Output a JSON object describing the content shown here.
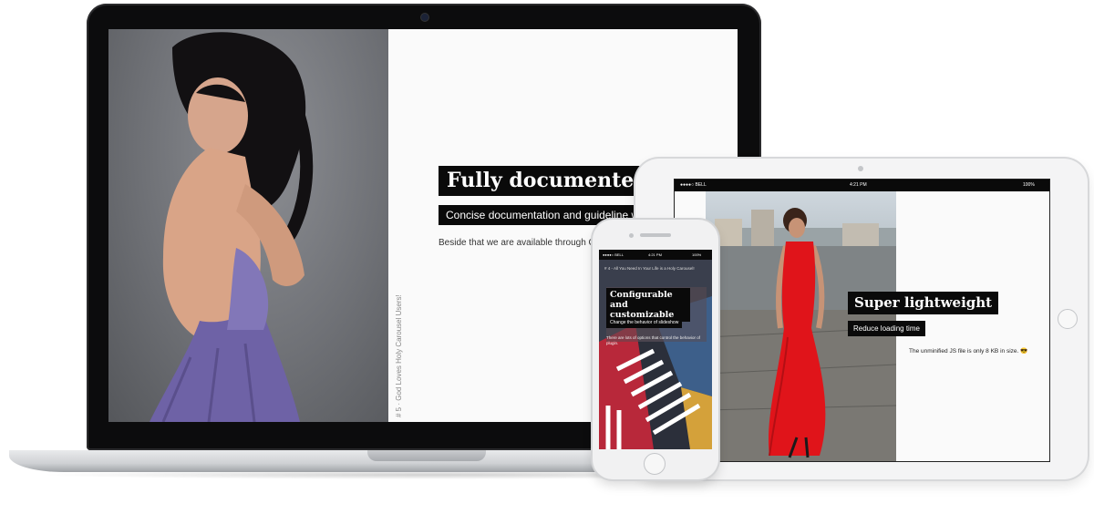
{
  "laptop": {
    "vertical_caption": "# 5 · God Loves Holy Carousel Users!",
    "title": "Fully documented",
    "subtitle": "Concise documentation and guideline will help",
    "description": "Beside that we are available through CodeCany and our email."
  },
  "tablet": {
    "status": {
      "carrier": "●●●●○ BELL ",
      "time": "4:21 PM",
      "battery": "100%"
    },
    "title": "Super lightweight",
    "subtitle": "Reduce loading time",
    "description": "The unminified JS file is only 8 KB in size. 😎"
  },
  "phone": {
    "status": {
      "carrier": "●●●●○ BELL",
      "time": "4:21 PM",
      "battery": "100%"
    },
    "header": "# 4 - All You Need In Your Life is a Holy Carousel!",
    "title": "Configurable and customizable",
    "subtitle": "Change the behavior of slideshow",
    "description": "There are lots of options that control the behavior of plugin."
  },
  "colors": {
    "caption_bg": "#0a0a0a",
    "caption_text": "#ffffff",
    "dress_purple": "#6e62a6",
    "dress_red": "#e0141a"
  }
}
